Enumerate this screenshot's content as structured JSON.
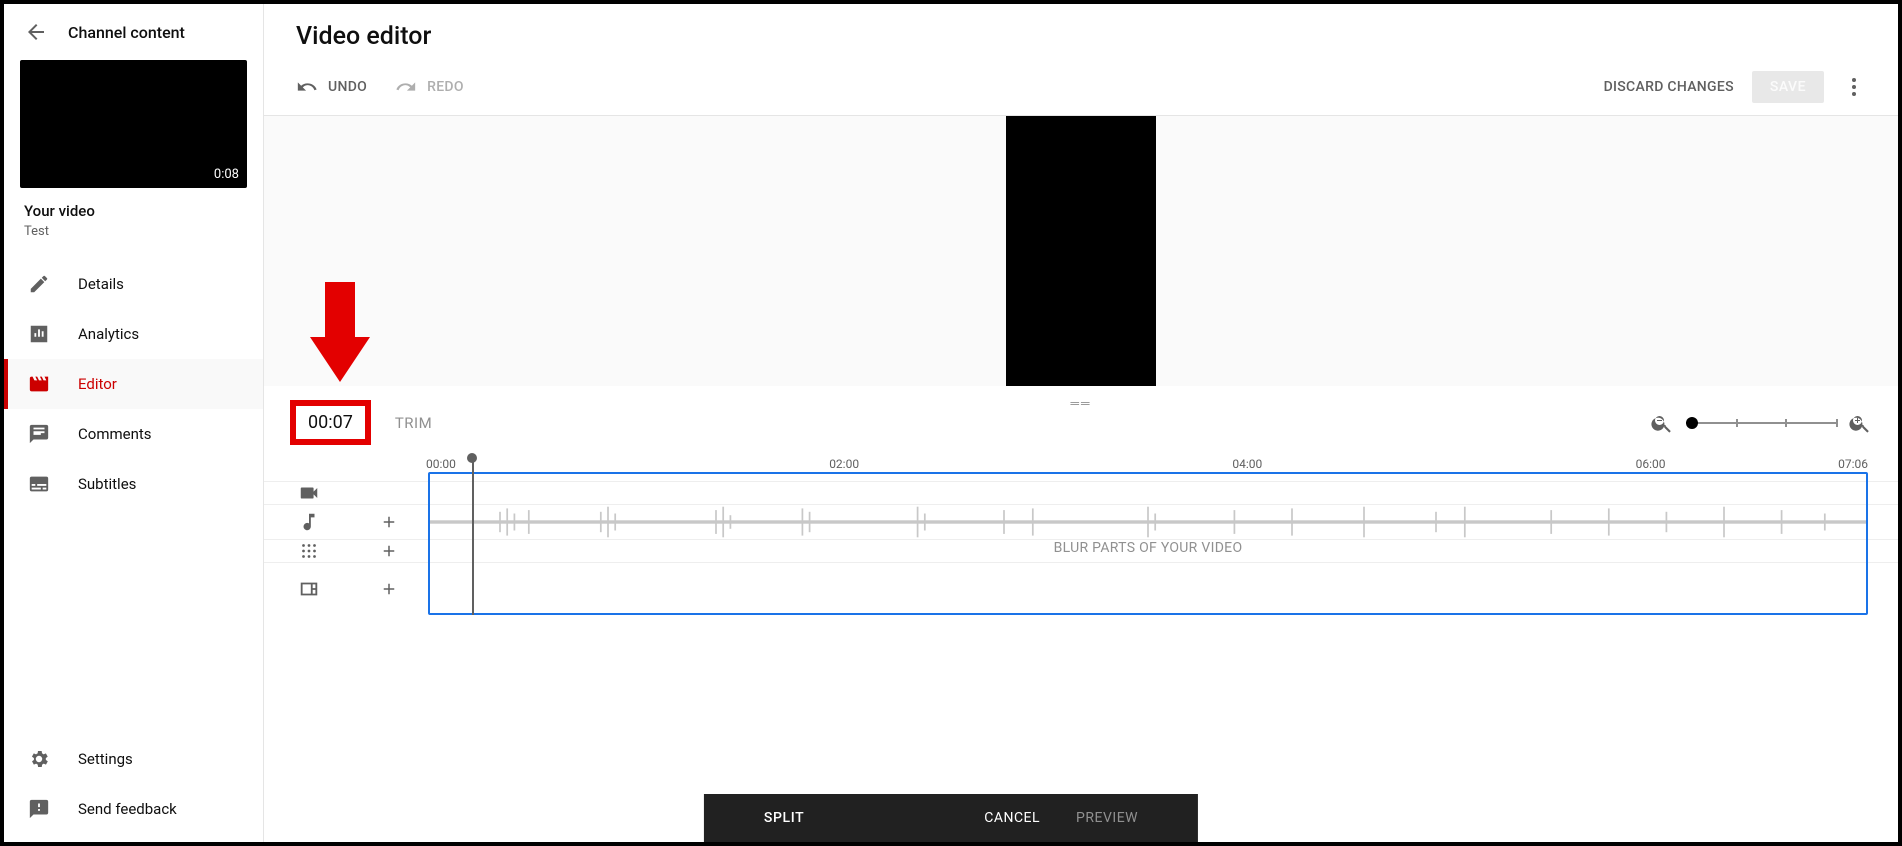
{
  "sidebar": {
    "header": "Channel content",
    "thumb_duration": "0:08",
    "your_video_label": "Your video",
    "video_title": "Test",
    "items": [
      {
        "label": "Details"
      },
      {
        "label": "Analytics"
      },
      {
        "label": "Editor"
      },
      {
        "label": "Comments"
      },
      {
        "label": "Subtitles"
      }
    ],
    "settings_label": "Settings",
    "feedback_label": "Send feedback"
  },
  "header": {
    "page_title": "Video editor",
    "undo": "UNDO",
    "redo": "REDO",
    "discard": "DISCARD CHANGES",
    "save": "SAVE"
  },
  "timeline": {
    "timecode": "00:07",
    "trim_label": "TRIM",
    "ruler": [
      "00:00",
      "02:00",
      "04:00",
      "06:00",
      "07:06"
    ],
    "blur_label": "BLUR PARTS OF YOUR VIDEO"
  },
  "action_bar": {
    "split": "SPLIT",
    "cancel": "CANCEL",
    "preview": "PREVIEW"
  }
}
